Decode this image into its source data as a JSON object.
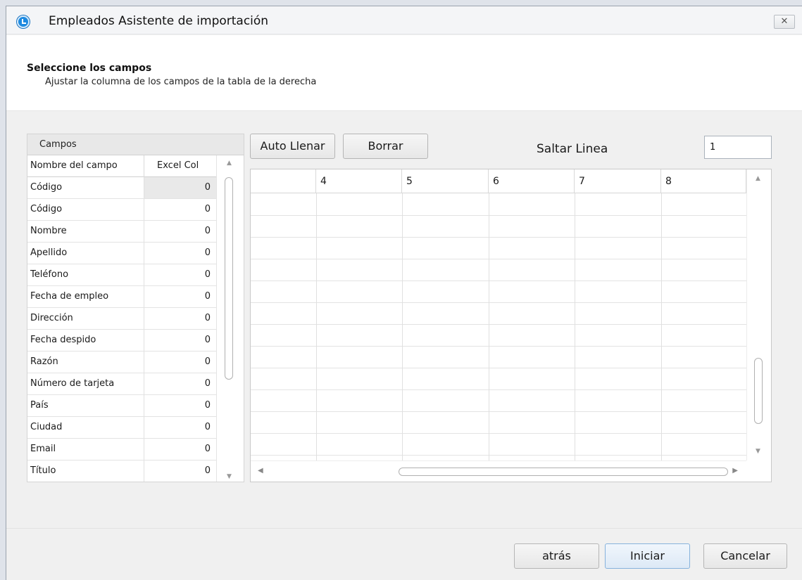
{
  "window": {
    "title": "Empleados Asistente de importación",
    "close_label": "✕"
  },
  "header": {
    "title": "Seleccione los campos",
    "subtitle": "Ajustar la columna de los campos de la tabla de la derecha"
  },
  "fields_panel": {
    "caption": "Campos",
    "col_name": "Nombre del campo",
    "col_excel": "Excel Col",
    "rows": [
      {
        "name": "Código",
        "col": "0"
      },
      {
        "name": "Código",
        "col": "0"
      },
      {
        "name": "Nombre",
        "col": "0"
      },
      {
        "name": "Apellido",
        "col": "0"
      },
      {
        "name": "Teléfono",
        "col": "0"
      },
      {
        "name": "Fecha de empleo",
        "col": "0"
      },
      {
        "name": "Dirección",
        "col": "0"
      },
      {
        "name": "Fecha despido",
        "col": "0"
      },
      {
        "name": "Razón",
        "col": "0"
      },
      {
        "name": "Número de tarjeta",
        "col": "0"
      },
      {
        "name": "País",
        "col": "0"
      },
      {
        "name": "Ciudad",
        "col": "0"
      },
      {
        "name": "Email",
        "col": "0"
      },
      {
        "name": "Título",
        "col": "0"
      }
    ]
  },
  "toolbar": {
    "auto_fill": "Auto Llenar",
    "clear": "Borrar",
    "skip_label": "Saltar Linea",
    "skip_value": "1"
  },
  "grid": {
    "columns": [
      "",
      "4",
      "5",
      "6",
      "7",
      "8"
    ]
  },
  "footer": {
    "back": "atrás",
    "start": "Iniciar",
    "cancel": "Cancelar"
  },
  "colors": {
    "accent": "#1e8ae0",
    "primary_button_border": "#86b2dc"
  }
}
